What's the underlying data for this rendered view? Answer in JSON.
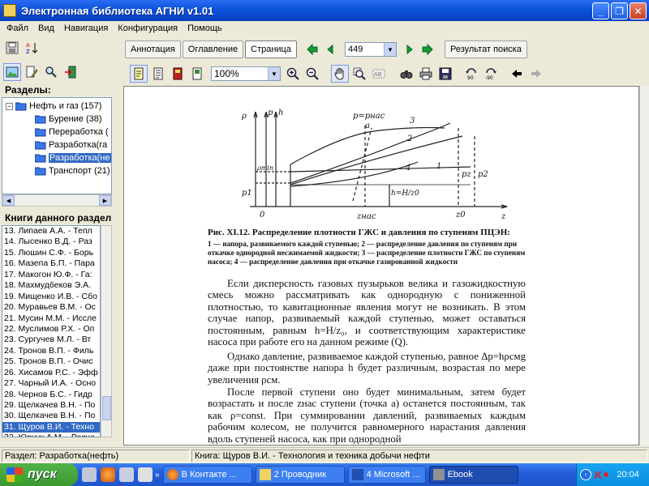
{
  "window": {
    "title": "Электронная библиотека АГНИ v1.01"
  },
  "menu": [
    "Файл",
    "Вид",
    "Навигация",
    "Конфигурация",
    "Помощь"
  ],
  "doc_tabs": [
    "Аннотация",
    "Оглавление",
    "Страница"
  ],
  "page_number": "449",
  "search_result_button": "Результат поиска",
  "zoom": "100%",
  "sections_label": "Разделы:",
  "tree": [
    {
      "label": "Нефть и газ (157)",
      "level": 0
    },
    {
      "label": "Бурение (38)",
      "level": 1
    },
    {
      "label": "Переработка (",
      "level": 1
    },
    {
      "label": "Разработка(га",
      "level": 1
    },
    {
      "label": "Разработка(не",
      "level": 1
    },
    {
      "label": "Транспорт (21)",
      "level": 1
    }
  ],
  "books_label": "Книги данного раздел",
  "books": [
    "13. Липаев А.А. - Тепл",
    "14. Лысенко В.Д. - Раз",
    "15. Люшин С.Ф. - Борь",
    "16. Мазепа Б.П. - Пара",
    "17. Макогон Ю.Ф. - Га:",
    "18. Махмудбеков Э.А.",
    "19. Мищенко И.В. - Сбо",
    "20. Муравьев В.М. - Ос",
    "21. Мусин М.М. - Иссле",
    "22. Муслимов Р.Х. - Оп",
    "23. Сургучев М.Л. - Вт",
    "24. Тронов В.П. - Филь",
    "25. Тронов В.П. - Очис",
    "26. Хисамов Р.С. - Эфф",
    "27. Чарный И.А. - Осно",
    "28. Чернов Б.С. - Гидр",
    "29. Щелкачев В.Н. - По",
    "30. Щелкачев В.Н. - По",
    "31. Щуров В.И. - Техно",
    "32. Юрчук А.М. - Расче"
  ],
  "selected_book_index": 18,
  "figure": {
    "axis_labels": [
      "ρ",
      "p",
      "h",
      "p=pнас",
      "a",
      "3",
      "2",
      "1",
      "4",
      "ρmin",
      "p1",
      "h=H/z0",
      "pz",
      "p2",
      "0",
      "zнас",
      "z0",
      "z"
    ],
    "caption_title": "Рис. XI.12. Распределение плотности ГЖС и давления по ступеням ПЦЭН:",
    "caption_text": "1 — напора, развиваемого каждой ступенью; 2 — распределение давления по ступеням при откачке однородной несжимаемой жидкости; 3 — распределение плотности ГЖС по ступеням насоса; 4 — распределение давления при откачке газированной жидкости"
  },
  "paragraphs": [
    "Если дисперсность газовых пузырьков велика и газожидкостную смесь можно рассматривать как однородную с пониженной плотностью, то кавитационные явления могут не возникать. В этом случае напор, развиваемый каждой ступенью, может оставаться постоянным, равным h=H/z₀, и соответствующим характеристике насоса при работе его на данном режиме (Q).",
    "Однако давление, развиваемое каждой ступенью, равное Δp=hρсмg даже при постоянстве напора h будет различным, возрастая по мере увеличения ρсм.",
    "После первой ступени оно будет минимальным, затем будет возрастать и после zнас ступени (точка a) останется постоянным, так как ρ=const. При суммировании давлений, развиваемых каждым рабочим колесом, не получится равномерного нарастания давления вдоль ступеней насоса, как при однородной"
  ],
  "status": {
    "section": "Раздел: Разработка(нефть)",
    "book": "Книга: Щуров В.И. - Технология и техника добычи нефти"
  },
  "taskbar": {
    "start": "пуск",
    "tasks": [
      "В Контакте ...",
      "2 Проводник",
      "4 Microsoft ...",
      "Ebook"
    ],
    "clock": "20:04"
  }
}
